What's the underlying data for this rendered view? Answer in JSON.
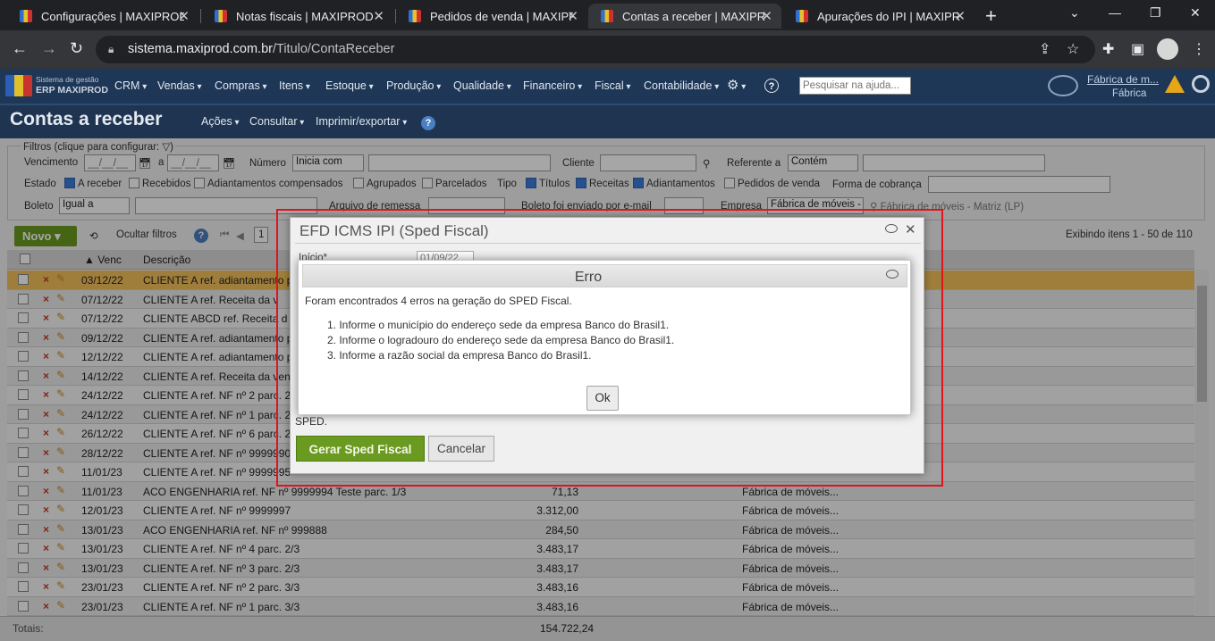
{
  "browser": {
    "tabs": [
      {
        "title": "Configurações | MAXIPROD",
        "active": false
      },
      {
        "title": "Notas fiscais | MAXIPROD",
        "active": false
      },
      {
        "title": "Pedidos de venda | MAXIPROD",
        "active": false
      },
      {
        "title": "Contas a receber | MAXIPROD",
        "active": true
      },
      {
        "title": "Apurações do IPI | MAXIPROD",
        "active": false
      }
    ],
    "url_host": "sistema.maxiprod.com.br",
    "url_path": "/Titulo/ContaReceber"
  },
  "app": {
    "logo_line1": "Sistema de gestão",
    "logo_line2": "ERP MAXIPROD",
    "menu": [
      "CRM",
      "Vendas",
      "Compras",
      "Itens",
      "Estoque",
      "Produção",
      "Qualidade",
      "Financeiro",
      "Fiscal",
      "Contabilidade"
    ],
    "search_placeholder": "Pesquisar na ajuda...",
    "company_link": "Fábrica de m...",
    "company_sub": "Fábrica"
  },
  "page": {
    "title": "Contas a receber",
    "menus": [
      "Ações",
      "Consultar",
      "Imprimir/exportar"
    ]
  },
  "filters": {
    "legend": "Filtros (clique para configurar:",
    "vencimento": "Vencimento",
    "date_placeholder": "__/__/__",
    "a": "a",
    "numero": "Número",
    "numero_op": "Inicia com",
    "cliente": "Cliente",
    "referente": "Referente a",
    "referente_op": "Contém",
    "estado": "Estado",
    "estados": [
      {
        "label": "A receber",
        "checked": true
      },
      {
        "label": "Recebidos",
        "checked": false
      },
      {
        "label": "Adiantamentos compensados",
        "checked": false
      },
      {
        "label": "Agrupados",
        "checked": false
      },
      {
        "label": "Parcelados",
        "checked": false
      }
    ],
    "tipo": "Tipo",
    "tipos": [
      {
        "label": "Títulos",
        "checked": true
      },
      {
        "label": "Receitas",
        "checked": true
      },
      {
        "label": "Adiantamentos",
        "checked": true
      },
      {
        "label": "Pedidos de venda",
        "checked": false
      }
    ],
    "forma_cobranca": "Forma de cobrança",
    "boleto": "Boleto",
    "boleto_op": "Igual a",
    "arquivo_remessa": "Arquivo de remessa",
    "boleto_email": "Boleto foi enviado por e-mail",
    "empresa": "Empresa",
    "empresa_value": "Fábrica de móveis -",
    "empresa_hint": "Fábrica de móveis - Matriz (LP)"
  },
  "toolbar": {
    "novo": "Novo",
    "ocultar": "Ocultar filtros",
    "page": "1",
    "exibindo": "Exibindo itens 1 - 50 de 110"
  },
  "grid": {
    "col_venc": "Venc",
    "col_desc": "Descrição",
    "rows": [
      {
        "venc": "03/12/22",
        "desc": "CLIENTE A ref. adiantamento p",
        "valor": "",
        "empresa": ""
      },
      {
        "venc": "07/12/22",
        "desc": "CLIENTE A ref. Receita da v",
        "valor": "",
        "empresa": ""
      },
      {
        "venc": "07/12/22",
        "desc": "CLIENTE ABCD ref. Receita d",
        "valor": "",
        "empresa": ""
      },
      {
        "venc": "09/12/22",
        "desc": "CLIENTE A ref. adiantamento p",
        "valor": "",
        "empresa": ""
      },
      {
        "venc": "12/12/22",
        "desc": "CLIENTE A ref. adiantamento p",
        "valor": "",
        "empresa": ""
      },
      {
        "venc": "14/12/22",
        "desc": "CLIENTE A ref. Receita da vend",
        "valor": "",
        "empresa": ""
      },
      {
        "venc": "24/12/22",
        "desc": "CLIENTE A ref. NF nº 2 parc. 2",
        "valor": "",
        "empresa": "o"
      },
      {
        "venc": "24/12/22",
        "desc": "CLIENTE A ref. NF nº 1 parc. 2",
        "valor": "",
        "empresa": "o"
      },
      {
        "venc": "26/12/22",
        "desc": "CLIENTE A ref. NF nº 6 parc. 2",
        "valor": "",
        "empresa": ""
      },
      {
        "venc": "28/12/22",
        "desc": "CLIENTE A ref. NF nº 9999990",
        "valor": "",
        "empresa": ""
      },
      {
        "venc": "11/01/23",
        "desc": "CLIENTE A ref. NF nº 9999995",
        "valor": "",
        "empresa": ""
      },
      {
        "venc": "11/01/23",
        "desc": "ACO ENGENHARIA ref. NF nº 9999994 Teste parc. 1/3",
        "valor": "71,13",
        "empresa": "Fábrica de móveis..."
      },
      {
        "venc": "12/01/23",
        "desc": "CLIENTE A ref. NF nº 9999997",
        "valor": "3.312,00",
        "empresa": "Fábrica de móveis..."
      },
      {
        "venc": "13/01/23",
        "desc": "ACO ENGENHARIA ref. NF nº 999888",
        "valor": "284,50",
        "empresa": "Fábrica de móveis..."
      },
      {
        "venc": "13/01/23",
        "desc": "CLIENTE A ref. NF nº 4 parc. 2/3",
        "valor": "3.483,17",
        "empresa": "Fábrica de móveis..."
      },
      {
        "venc": "13/01/23",
        "desc": "CLIENTE A ref. NF nº 3 parc. 2/3",
        "valor": "3.483,17",
        "empresa": "Fábrica de móveis..."
      },
      {
        "venc": "23/01/23",
        "desc": "CLIENTE A ref. NF nº 2 parc. 3/3",
        "valor": "3.483,16",
        "empresa": "Fábrica de móveis..."
      },
      {
        "venc": "23/01/23",
        "desc": "CLIENTE A ref. NF nº 1 parc. 3/3",
        "valor": "3.483,16",
        "empresa": "Fábrica de móveis..."
      }
    ],
    "totals_label": "Totais:",
    "totals_value": "154.722,24"
  },
  "efd_dialog": {
    "title": "EFD ICMS IPI (Sped Fiscal)",
    "inicio_label": "Início*",
    "inicio_value": "01/09/22",
    "note": "SPED.",
    "gerar": "Gerar Sped Fiscal",
    "cancelar": "Cancelar"
  },
  "erro_dialog": {
    "title": "Erro",
    "message": "Foram encontrados 4 erros na geração do SPED Fiscal.",
    "errors": [
      "1. Informe o município do endereço sede da empresa Banco do Brasil1.",
      "2. Informe o logradouro do endereço sede da empresa Banco do Brasil1.",
      "3. Informe a razão social da empresa Banco do Brasil1."
    ],
    "ok": "Ok"
  }
}
